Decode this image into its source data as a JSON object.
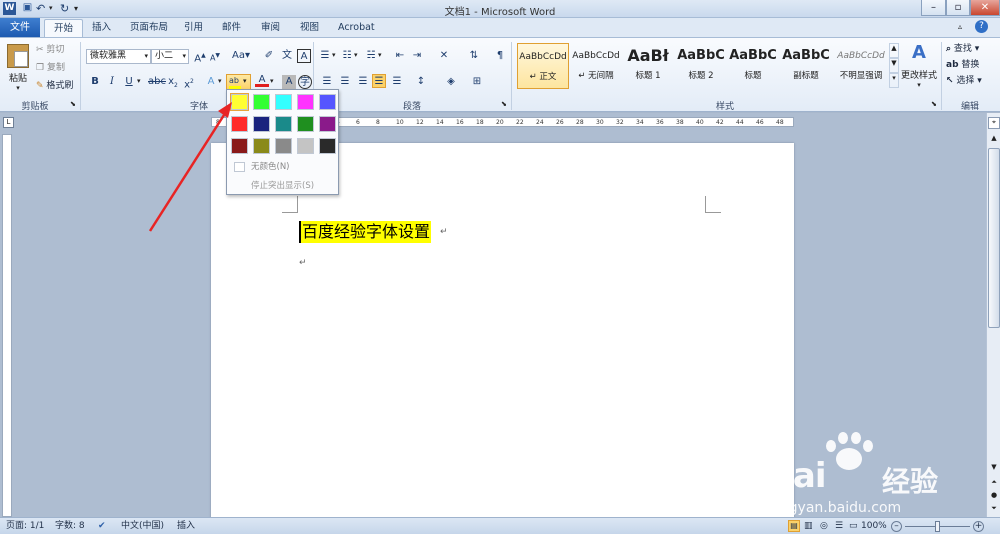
{
  "window": {
    "title": "文档1 - Microsoft Word"
  },
  "tabs": [
    "文件",
    "开始",
    "插入",
    "页面布局",
    "引用",
    "邮件",
    "审阅",
    "视图",
    "Acrobat"
  ],
  "clipboard": {
    "paste": "粘贴",
    "cut": "剪切",
    "copy": "复制",
    "format_painter": "格式刷",
    "group": "剪贴板"
  },
  "font": {
    "name": "微软雅黑",
    "size": "小二",
    "group": "字体"
  },
  "paragraph": {
    "group": "段落"
  },
  "styles": {
    "group": "样式",
    "items": [
      {
        "sample": "AaBbCcDd",
        "name": "↵ 正文"
      },
      {
        "sample": "AaBbCcDd",
        "name": "↵ 无间隔"
      },
      {
        "sample": "AaBł",
        "name": "标题 1"
      },
      {
        "sample": "AaBbC",
        "name": "标题 2"
      },
      {
        "sample": "AaBbC",
        "name": "标题"
      },
      {
        "sample": "AaBbC",
        "name": "副标题"
      },
      {
        "sample": "AaBbCcDd",
        "name": "不明显强调"
      }
    ],
    "change": "更改样式"
  },
  "editing": {
    "group": "编辑",
    "find": "查找",
    "replace": "替换",
    "select": "选择"
  },
  "highlight_menu": {
    "colors": [
      [
        "#ffff33",
        "#33ff33",
        "#33ffff",
        "#ff33ff",
        "#5555ff"
      ],
      [
        "#ff2a2a",
        "#1a237e",
        "#1a8a8a",
        "#1f8f1f",
        "#8a1a8a"
      ],
      [
        "#8a1a1a",
        "#8a8a1a",
        "#8a8a8a",
        "#c4c4c4",
        "#2a2a2a"
      ]
    ],
    "no_color": "无颜色(N)",
    "stop": "停止突出显示(S)"
  },
  "ruler": {
    "ticks": [
      "8",
      "6",
      "4",
      "2",
      "",
      "2",
      "4",
      "6",
      "8",
      "10",
      "12",
      "14",
      "16",
      "18",
      "20",
      "22",
      "24",
      "26",
      "28",
      "30",
      "32",
      "34",
      "36",
      "38",
      "40",
      "42",
      "44",
      "46",
      "48"
    ]
  },
  "document": {
    "text": "百度经验字体设置",
    "highlight": "#ffff00"
  },
  "status": {
    "page": "页面: 1/1",
    "words": "字数: 8",
    "lang": "中文(中国)",
    "mode": "插入",
    "zoom": "100%"
  },
  "watermark": {
    "brand": "Bai",
    "brand2": "经验",
    "url": "jingyan.baidu.com"
  }
}
